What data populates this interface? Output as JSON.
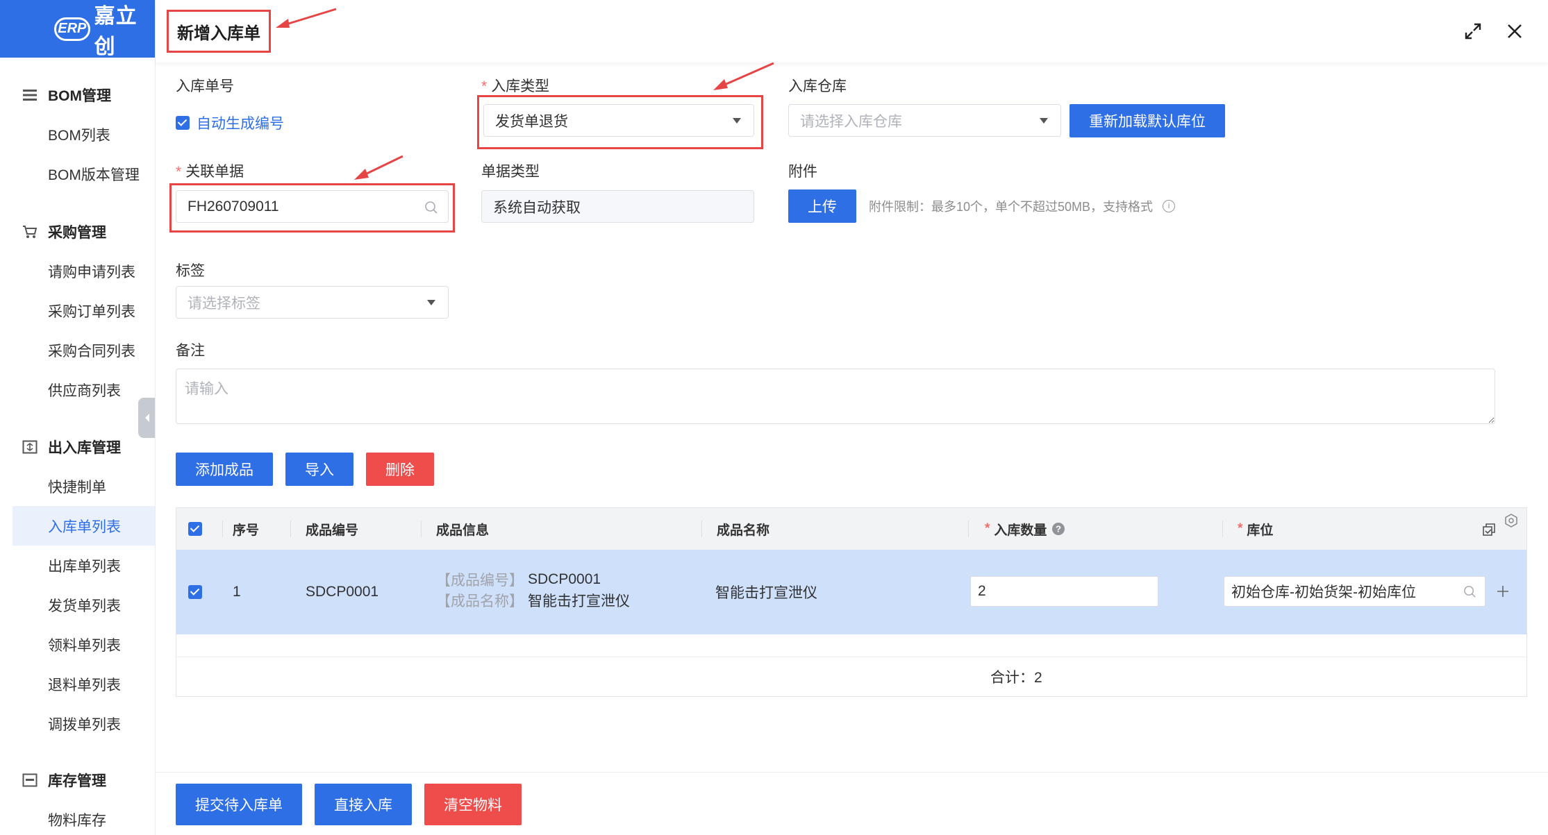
{
  "sidebar": {
    "brand": "嘉立创",
    "logo_mark": "ERP",
    "groups": [
      {
        "title": "BOM管理",
        "items": [
          "BOM列表",
          "BOM版本管理"
        ]
      },
      {
        "title": "采购管理",
        "items": [
          "请购申请列表",
          "采购订单列表",
          "采购合同列表",
          "供应商列表"
        ]
      },
      {
        "title": "出入库管理",
        "items": [
          "快捷制单",
          "入库单列表",
          "出库单列表",
          "发货单列表",
          "领料单列表",
          "退料单列表",
          "调拨单列表"
        ]
      },
      {
        "title": "库存管理",
        "items": [
          "物料库存"
        ]
      }
    ],
    "active_item": "入库单列表"
  },
  "dialog": {
    "title": "新增入库单",
    "form": {
      "order_no_label": "入库单号",
      "auto_number_label": "自动生成编号",
      "auto_number_checked": true,
      "type_label": "入库类型",
      "type_value": "发货单退货",
      "warehouse_label": "入库仓库",
      "warehouse_placeholder": "请选择入库仓库",
      "reload_button": "重新加载默认库位",
      "related_label": "关联单据",
      "related_value": "FH260709011",
      "doc_type_label": "单据类型",
      "doc_type_value": "系统自动获取",
      "attachment_label": "附件",
      "upload_button": "上传",
      "attachment_hint": "附件限制：最多10个，单个不超过50MB，支持格式",
      "tag_label": "标签",
      "tag_placeholder": "请选择标签",
      "remark_label": "备注",
      "remark_placeholder": "请输入"
    },
    "actions": {
      "add": "添加成品",
      "import": "导入",
      "delete": "删除"
    },
    "table": {
      "headers": {
        "seq": "序号",
        "code": "成品编号",
        "info": "成品信息",
        "name": "成品名称",
        "qty": "入库数量",
        "location": "库位"
      },
      "rows": [
        {
          "checked": true,
          "seq": "1",
          "code": "SDCP0001",
          "info_code_label": "【成品编号】",
          "info_code": "SDCP0001",
          "info_name_label": "【成品名称】",
          "info_name": "智能击打宣泄仪",
          "name": "智能击打宣泄仪",
          "qty": "2",
          "location": "初始仓库-初始货架-初始库位"
        }
      ],
      "total": "合计：2"
    },
    "footer": {
      "submit_pending": "提交待入库单",
      "direct": "直接入库",
      "clear": "清空物料"
    }
  }
}
